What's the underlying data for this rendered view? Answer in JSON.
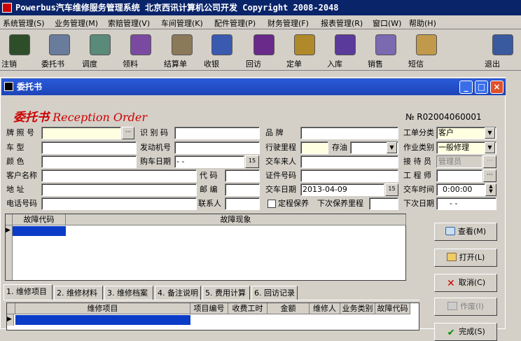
{
  "app": {
    "title": "Powerbus汽车维修服务管理系统 北京西讯计算机公司开发 Copyright 2008-2048"
  },
  "menu": [
    "系统管理(S)",
    "业务管理(M)",
    "索赔管理(V)",
    "车间管理(K)",
    "配件管理(P)",
    "财务管理(F)",
    "报表管理(R)",
    "窗口(W)",
    "帮助(H)"
  ],
  "toolbar": [
    {
      "label": "注销",
      "icon": "logout-icon",
      "color": "#2e4e2a"
    },
    {
      "label": "委托书",
      "icon": "entrust-icon",
      "color": "#6a7c9c"
    },
    {
      "label": "调度",
      "icon": "dispatch-icon",
      "color": "#5a8a7a"
    },
    {
      "label": "领料",
      "icon": "material-icon",
      "color": "#7a4aa0"
    },
    {
      "label": "结算单",
      "icon": "settlement-icon",
      "color": "#8a7a5a"
    },
    {
      "label": "收银",
      "icon": "cashier-icon",
      "color": "#3a5ab0"
    },
    {
      "label": "回访",
      "icon": "revisit-icon",
      "color": "#6a2a8a"
    },
    {
      "label": "定单",
      "icon": "order-icon",
      "color": "#b08a2a"
    },
    {
      "label": "入库",
      "icon": "warehouse-icon",
      "color": "#5a3a9a"
    },
    {
      "label": "销售",
      "icon": "sales-icon",
      "color": "#7a6ab0"
    },
    {
      "label": "短信",
      "icon": "sms-icon",
      "color": "#c09a4a"
    },
    {
      "label": "退出",
      "icon": "exit-icon",
      "color": "#3a5aa0"
    }
  ],
  "window": {
    "title": "委托书",
    "minimize": "_",
    "maximize": "□",
    "close": "×"
  },
  "form": {
    "heading_cn": "委托书",
    "heading_en": "Reception Order",
    "order_no": "№ R02004060001",
    "labels": {
      "plate": "牌 照 号",
      "car_type": "车   型",
      "color": "颜   色",
      "customer": "客户名称",
      "address": "地   址",
      "phone": "电话号码",
      "vin": "识 别 码",
      "engine": "发动机号",
      "buy_date": "购车日期",
      "zip_code": "代   码",
      "postal": "邮   编",
      "contact": "联系人",
      "brand": "品   牌",
      "mileage": "行驶里程",
      "fuel": "存油",
      "deliverer": "交车来人",
      "id_no": "证件号码",
      "deliver_date": "交车日期",
      "regular_maint": "定程保养",
      "next_maint": "下次保养里程",
      "order_class": "工单分类",
      "job_type": "作业类别",
      "receiver": "接 待 员",
      "engineer": "工 程 师",
      "deliver_time": "交车时间",
      "next_date": "下次日期"
    },
    "values": {
      "buy_date": "  -  -",
      "deliver_date": "2013-04-09",
      "order_class": "客户",
      "job_type": "一般修理",
      "receiver": "管理员",
      "deliver_time": "0:00:00",
      "next_date": "  -  -",
      "date_btn": "15"
    }
  },
  "fault_grid": {
    "columns": [
      "故障代码",
      "故障现象"
    ]
  },
  "tabs": [
    "1. 维修项目",
    "2. 维修材料",
    "3. 维修档案",
    "4. 备注说明",
    "5. 费用计算",
    "6. 回访记录"
  ],
  "repair_grid": {
    "columns": [
      "维修项目",
      "项目编号",
      "收费工时",
      "金额",
      "维修人",
      "业务类别",
      "故障代码"
    ]
  },
  "actions": [
    {
      "label": "查看(M)",
      "name": "view-button",
      "disabled": false
    },
    {
      "label": "打开(L)",
      "name": "open-button",
      "disabled": false
    },
    {
      "label": "取消(C)",
      "name": "cancel-button",
      "disabled": false
    },
    {
      "label": "作废(I)",
      "name": "void-button",
      "disabled": true
    },
    {
      "label": "完成(S)",
      "name": "complete-button",
      "disabled": false
    }
  ]
}
